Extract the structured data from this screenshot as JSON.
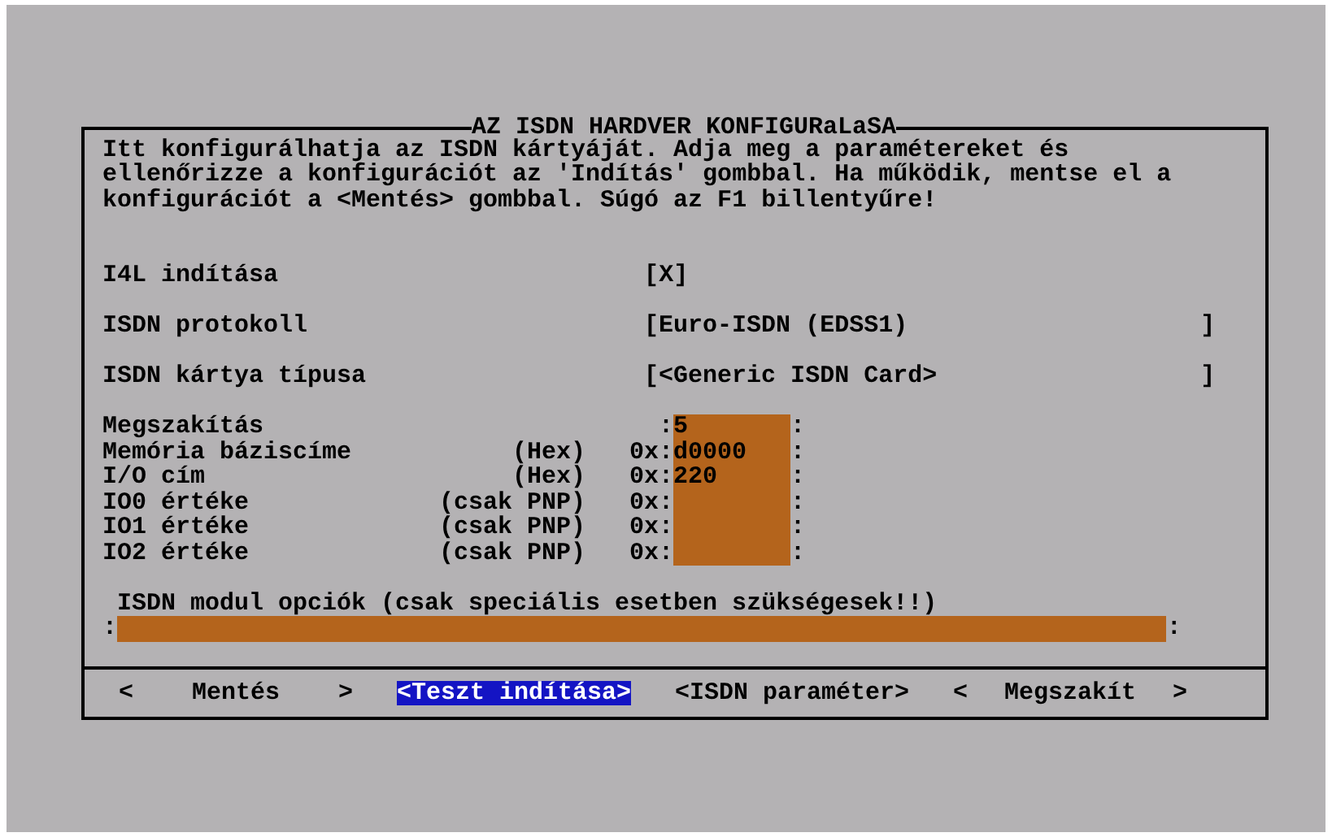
{
  "dialog": {
    "title": "AZ ISDN HARDVER KONFIGURaLaSA",
    "intro": "Itt konfigurálhatja az ISDN kártyáját. Adja meg a paramétereket és\nellenőrizze a konfigurációt az 'Indítás' gombbal. Ha működik, mentse el a\nkonfigurációt a <Mentés> gombbal. Súgó az F1 billentyűre!",
    "options": [
      {
        "kind": "checkbox",
        "label": "I4L indítása",
        "open": "[",
        "mark": "X",
        "close": "]",
        "checked": true
      },
      {
        "kind": "select",
        "label": "ISDN protokoll",
        "value": "[Euro-ISDN (EDSS1)",
        "close": "]"
      },
      {
        "kind": "select",
        "label": "ISDN kártya típusa",
        "value": "[<Generic ISDN Card>",
        "close": "]"
      }
    ],
    "fields": [
      {
        "label": "Megszakítás",
        "prefix": ":",
        "value": "5",
        "suffix": ":"
      },
      {
        "label": "Memória báziscíme",
        "unit": "(Hex)",
        "prefix": "0x:",
        "value": "d0000",
        "suffix": ":"
      },
      {
        "label": "I/O cím",
        "unit": "(Hex)",
        "prefix": "0x:",
        "value": "220",
        "suffix": ":"
      },
      {
        "label": "IO0 értéke",
        "unit": "(csak PNP)",
        "prefix": "0x:",
        "suffix": ":"
      },
      {
        "label": "IO1 értéke",
        "unit": "(csak PNP)",
        "prefix": "0x:",
        "suffix": ":"
      },
      {
        "label": "IO2 értéke",
        "unit": "(csak PNP)",
        "prefix": "0x:",
        "suffix": ":"
      }
    ],
    "module_options": {
      "label": "ISDN modul opciók (csak speciális esetben szükségesek!!)",
      "prefix": ":",
      "suffix": ":"
    },
    "buttons": [
      {
        "left": "<",
        "label": "Mentés",
        "right": ">",
        "selected": false
      },
      {
        "label": "<Teszt indítása>",
        "selected": true
      },
      {
        "label": "<ISDN paraméter>",
        "selected": false
      },
      {
        "left": "<",
        "label": "Megszakít",
        "right": ">",
        "selected": false
      }
    ]
  }
}
